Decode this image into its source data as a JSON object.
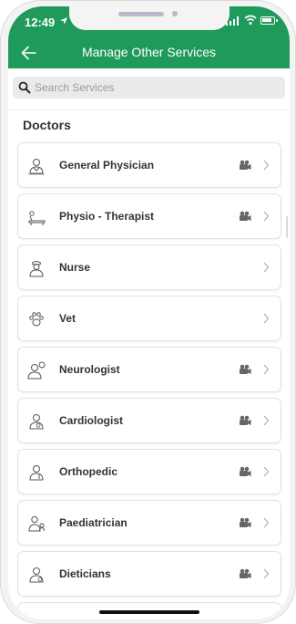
{
  "status_bar": {
    "time": "12:49"
  },
  "header": {
    "title": "Manage Other Services"
  },
  "search": {
    "placeholder": "Search Services",
    "value": ""
  },
  "section": {
    "title": "Doctors"
  },
  "services": [
    {
      "label": "General Physician",
      "icon": "doctor-icon",
      "has_video": true
    },
    {
      "label": "Physio - Therapist",
      "icon": "massage-table-icon",
      "has_video": true
    },
    {
      "label": "Nurse",
      "icon": "nurse-icon",
      "has_video": false
    },
    {
      "label": "Vet",
      "icon": "paw-icon",
      "has_video": false
    },
    {
      "label": "Neurologist",
      "icon": "brain-doctor-icon",
      "has_video": true
    },
    {
      "label": "Cardiologist",
      "icon": "doctor-icon",
      "has_video": true
    },
    {
      "label": "Orthopedic",
      "icon": "doctor-icon",
      "has_video": true
    },
    {
      "label": "Paediatrician",
      "icon": "child-doctor-icon",
      "has_video": true
    },
    {
      "label": "Dieticians",
      "icon": "doctor-icon",
      "has_video": true
    }
  ],
  "colors": {
    "accent": "#1f9a5a",
    "search_bg": "#eaeaea",
    "text": "#333333"
  }
}
